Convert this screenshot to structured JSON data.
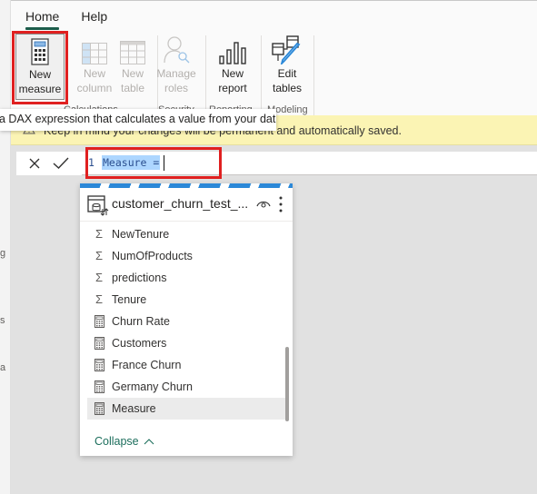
{
  "left_strip_fragments": [
    "g",
    "s",
    "a"
  ],
  "ribbon": {
    "tabs": [
      {
        "label": "Home",
        "active": true
      },
      {
        "label": "Help",
        "active": false
      }
    ],
    "buttons": [
      {
        "id": "new-measure",
        "label1": "New",
        "label2": "measure",
        "icon": "calculator-icon",
        "enabled": true,
        "selected": true
      },
      {
        "id": "new-column",
        "label1": "New",
        "label2": "column",
        "icon": "column-grid-icon",
        "enabled": false
      },
      {
        "id": "new-table",
        "label1": "New",
        "label2": "table",
        "icon": "table-grid-icon",
        "enabled": false
      },
      {
        "id": "manage-roles",
        "label1": "Manage",
        "label2": "roles",
        "icon": "user-key-icon",
        "enabled": false
      },
      {
        "id": "new-report",
        "label1": "New",
        "label2": "report",
        "icon": "bar-chart-icon",
        "enabled": true
      },
      {
        "id": "edit-tables",
        "label1": "Edit",
        "label2": "tables",
        "icon": "edit-tables-icon",
        "enabled": true
      }
    ],
    "groups": [
      "Calculations",
      "Security",
      "Reporting",
      "Modeling"
    ]
  },
  "tooltip": "a DAX expression that calculates a value from your data.",
  "warning": {
    "icon": "warning-icon",
    "text": "Keep in mind your changes will be permanent and automatically saved."
  },
  "formula_bar": {
    "cancel_icon": "close-icon",
    "commit_icon": "check-icon",
    "line_number": "1",
    "code": "Measure = "
  },
  "field_list": {
    "table_name": "customer_churn_test_...",
    "items": [
      {
        "label": "NewTenure",
        "type": "sum"
      },
      {
        "label": "NumOfProducts",
        "type": "sum"
      },
      {
        "label": "predictions",
        "type": "sum"
      },
      {
        "label": "Tenure",
        "type": "sum"
      },
      {
        "label": "Churn Rate",
        "type": "measure"
      },
      {
        "label": "Customers",
        "type": "measure"
      },
      {
        "label": "France Churn",
        "type": "measure"
      },
      {
        "label": "Germany Churn",
        "type": "measure"
      },
      {
        "label": "Measure",
        "type": "measure",
        "selected": true
      }
    ],
    "collapse_label": "Collapse"
  },
  "colors": {
    "accent_green": "#1c5c4a",
    "highlight_red": "#e02020",
    "warning_bg": "#fbf4b4",
    "selection_blue": "#add6ff"
  }
}
